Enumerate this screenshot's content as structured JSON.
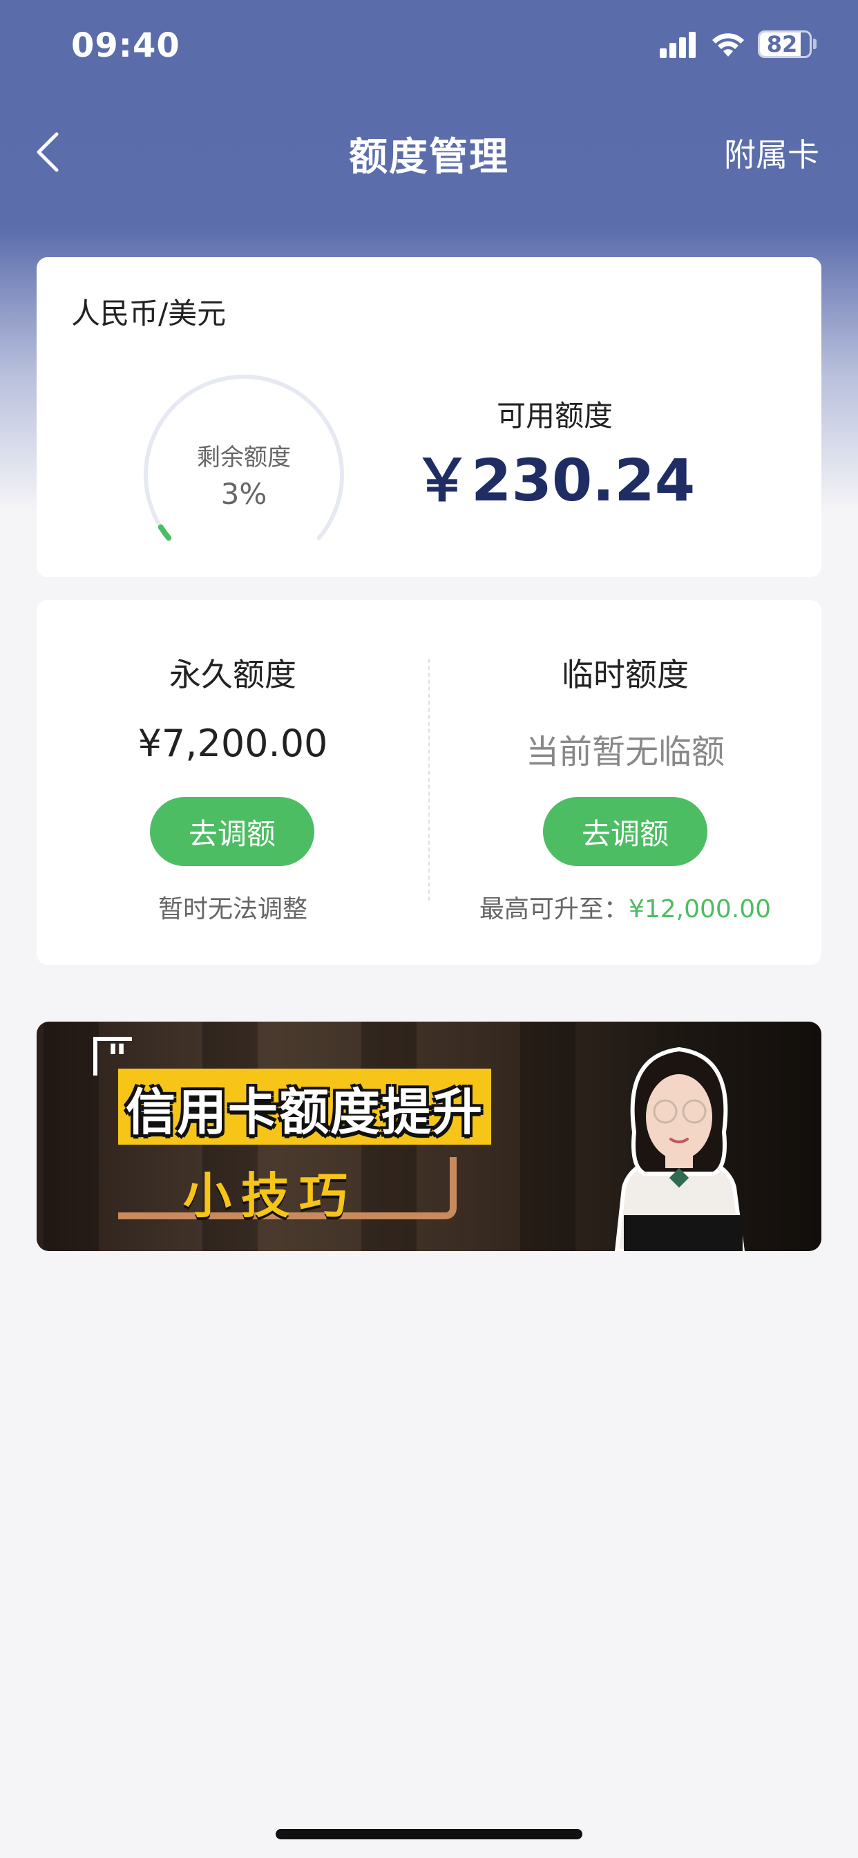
{
  "status_bar": {
    "time": "09:40",
    "battery": "82",
    "battery_level": 0.82
  },
  "nav": {
    "title": "额度管理",
    "right_label": "附属卡"
  },
  "summary": {
    "currency": "人民币/美元",
    "gauge_label": "剩余额度",
    "gauge_percent": "3%",
    "gauge_fraction": 0.03,
    "available_label": "可用额度",
    "available_amount": "￥230.24"
  },
  "limits": {
    "permanent": {
      "title": "永久额度",
      "value": "¥7,200.00",
      "button": "去调额",
      "note": "暂时无法调整"
    },
    "temporary": {
      "title": "临时额度",
      "value": "当前暂无临额",
      "button": "去调额",
      "note_prefix": "最高可升至：",
      "note_amount": "¥12,000.00"
    }
  },
  "banner": {
    "title": "信用卡额度提升",
    "subtitle": "小技巧"
  },
  "colors": {
    "header": "#5a6ca9",
    "accent_green": "#4dbd63",
    "amount_navy": "#1f2d64",
    "banner_yellow": "#f6c518"
  }
}
